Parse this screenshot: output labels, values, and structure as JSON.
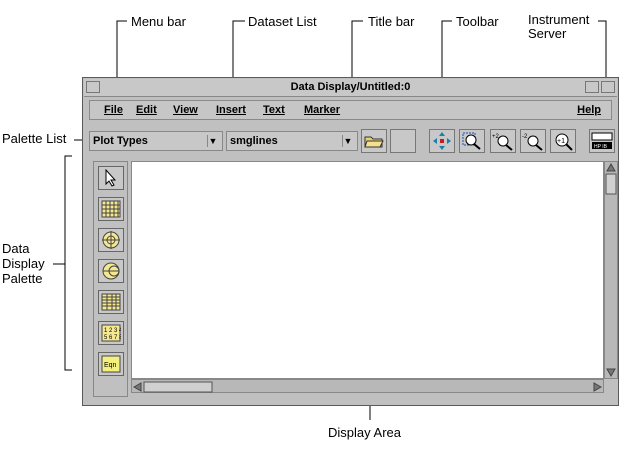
{
  "callouts": {
    "menu_bar": "Menu bar",
    "dataset_list": "Dataset List",
    "title_bar": "Title bar",
    "toolbar": "Toolbar",
    "instrument_server": "Instrument\nServer",
    "palette_list": "Palette List",
    "data_display_palette": "Data\nDisplay\nPalette",
    "display_area": "Display Area"
  },
  "window": {
    "title": "Data Display/Untitled:0",
    "menus": [
      "File",
      "Edit",
      "View",
      "Insert",
      "Text",
      "Marker"
    ],
    "help": "Help"
  },
  "toolbar": {
    "palette_list_value": "Plot Types",
    "dataset_list_value": "smglines",
    "buttons": [
      "open-folder-icon",
      "blank-icon",
      "move-arrows-icon",
      "zoom-box-icon",
      "zoom-in-icon",
      "zoom-out-icon",
      "zoom-reset-icon",
      "instrument-server-icon"
    ],
    "zoom_in_label": "+2",
    "zoom_out_label": "-2",
    "zoom_reset_label": "+1",
    "instrument_server_label": "HP IB"
  },
  "palette": {
    "items": [
      "pointer-icon",
      "grid-icon",
      "polar-icon",
      "smith-icon",
      "table-icon",
      "list-icon",
      "equation-icon"
    ],
    "list_icon_text": "1 2 3 4\n5 6 7 8",
    "equation_icon_text": "Eqn"
  }
}
